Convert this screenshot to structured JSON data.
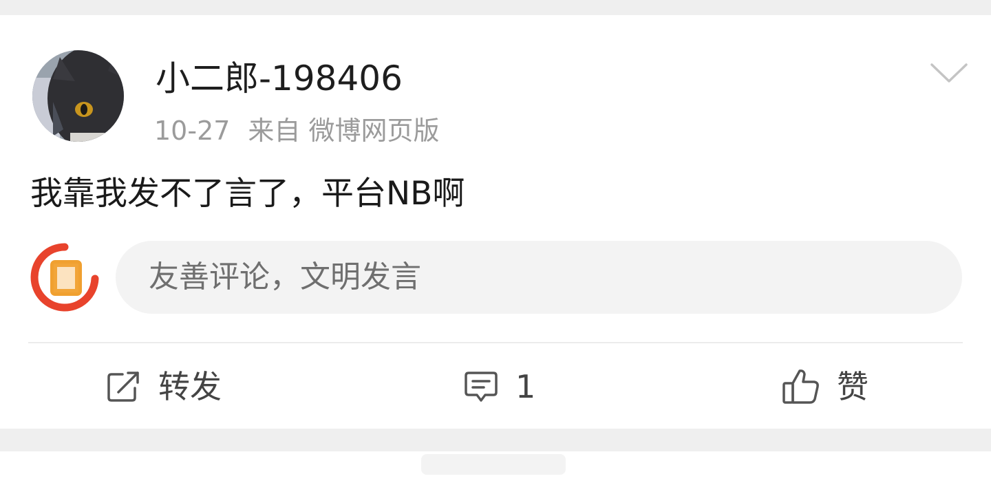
{
  "post": {
    "username": "小二郎-198406",
    "time": "10-27",
    "source": "来自 微博网页版",
    "text": "我靠我发不了言了，平台NB啊"
  },
  "icons": {
    "avatar": "cat-avatar",
    "more": "chevron-down-icon",
    "my_avatar": "weibo-d-logo",
    "repost": "repost-icon",
    "comment": "comment-icon",
    "like": "thumbs-up-icon"
  },
  "comment_input": {
    "placeholder": "友善评论，文明发言"
  },
  "actions": {
    "repost_label": "转发",
    "comment_count": "1",
    "like_label": "赞"
  },
  "colors": {
    "background": "#ffffff",
    "separator": "#efefef",
    "text_primary": "#1e1e1e",
    "text_secondary": "#9b9b9b",
    "input_bg": "#f3f3f3",
    "logo_red": "#e8432c",
    "logo_orange": "#f0a030"
  }
}
